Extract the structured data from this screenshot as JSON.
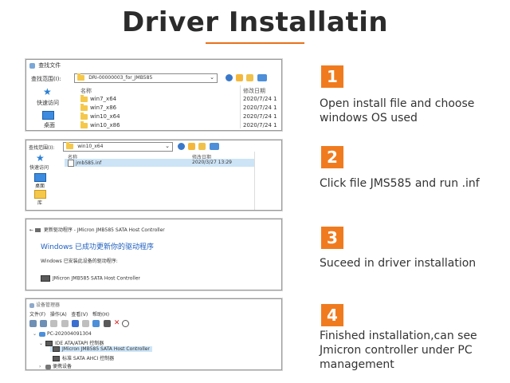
{
  "title": "Driver Installatin",
  "steps": [
    {
      "number": "1",
      "text": "Open install file and choose windows OS used"
    },
    {
      "number": "2",
      "text": "Click file JMS585 and run .inf"
    },
    {
      "number": "3",
      "text": "Suceed in driver installation"
    },
    {
      "number": "4",
      "text": "Finished installation,can see Jmicron controller under PC management"
    }
  ],
  "shot1": {
    "window_title": "查找文件",
    "lookin_label": "查找范围(I):",
    "path": "DRI-00000003_for_JMB585",
    "nav_quick": "快速访问",
    "nav_desktop": "桌面",
    "col_name": "名称",
    "col_date": "修改日期",
    "rows": [
      {
        "name": "win7_x64",
        "date": "2020/7/24 1"
      },
      {
        "name": "win7_x86",
        "date": "2020/7/24 1"
      },
      {
        "name": "win10_x64",
        "date": "2020/7/24 1"
      },
      {
        "name": "win10_x86",
        "date": "2020/7/24 1"
      }
    ]
  },
  "shot2": {
    "lookin_label": "查找范围(I):",
    "path": "win10_x64",
    "nav_quick": "快速访问",
    "nav_desktop": "桌面",
    "nav_lib": "库",
    "col_name": "名称",
    "col_date": "修改日期",
    "file_name": "jmb585.inf",
    "file_date": "2020/3/27 13:29"
  },
  "shot3": {
    "window_title": "更新驱动程序 - JMicron JMB585 SATA Host Controller",
    "success_heading": "Windows 已成功更新你的驱动程序",
    "installed_for": "Windows 已安装此设备的驱动程序:",
    "device": "JMicron JMB585 SATA Host Controller"
  },
  "shot4": {
    "window_title": "设备管理器",
    "menu": [
      "文件(F)",
      "操作(A)",
      "查看(V)",
      "帮助(H)"
    ],
    "tree": [
      {
        "label": "PC-202004091304",
        "indent": 0
      },
      {
        "label": "IDE ATA/ATAPI 控制器",
        "indent": 1
      },
      {
        "label": "JMicron JMB585 SATA Host Controller",
        "indent": 2,
        "selected": true
      },
      {
        "label": "标准 SATA AHCI 控制器",
        "indent": 2
      },
      {
        "label": "便携设备",
        "indent": 1
      }
    ]
  }
}
